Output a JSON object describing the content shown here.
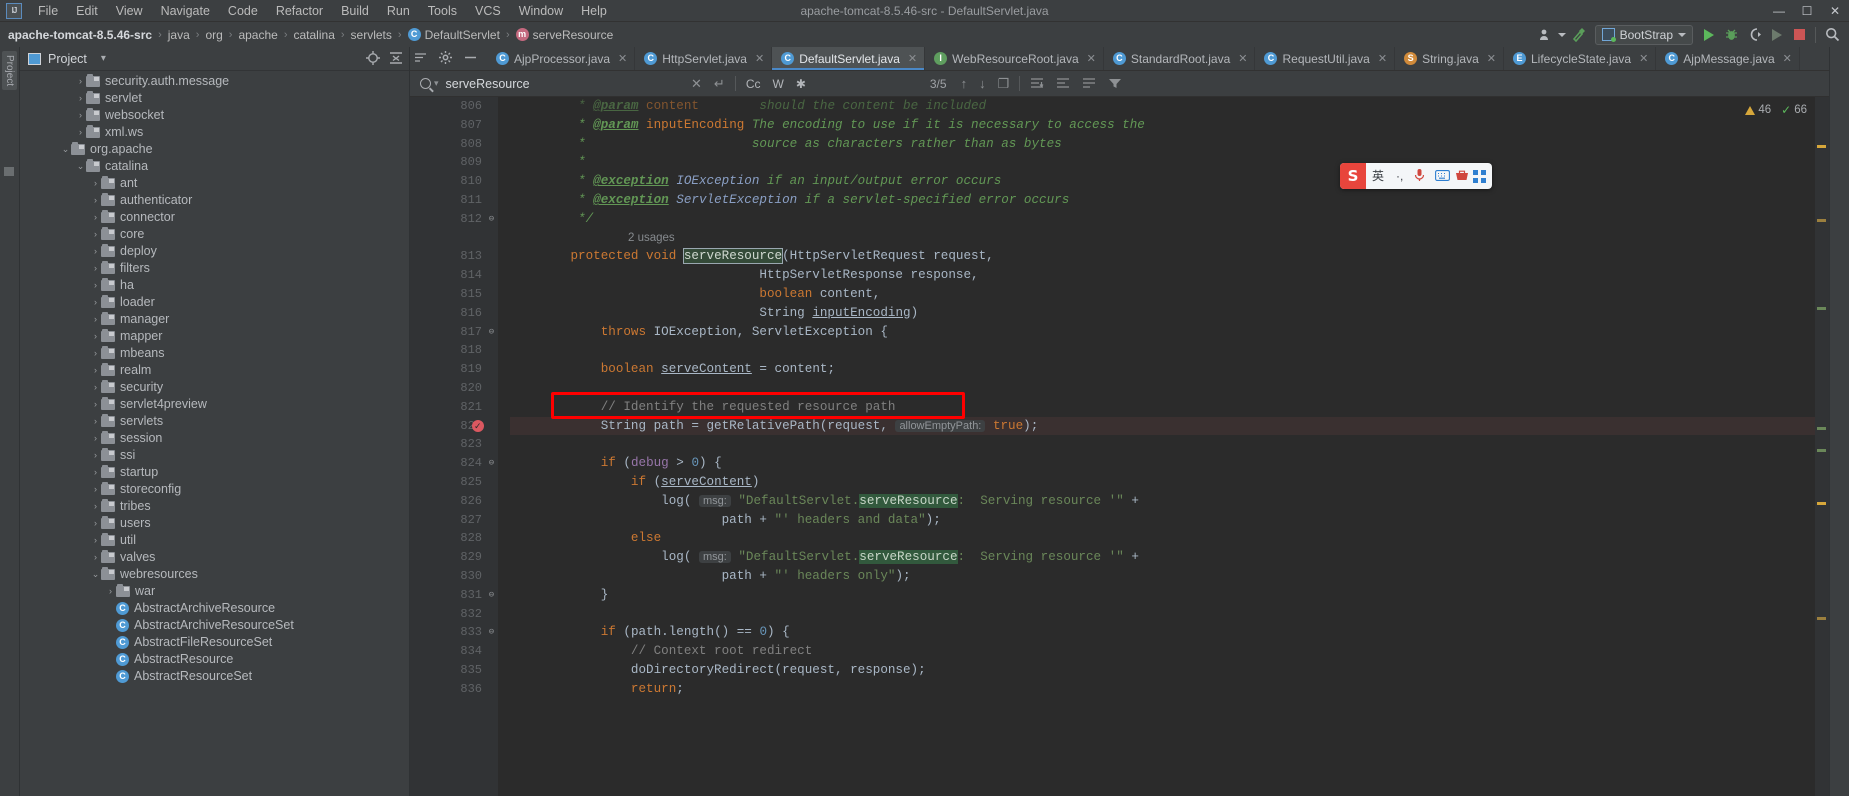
{
  "window": {
    "title": "apache-tomcat-8.5.46-src - DefaultServlet.java",
    "logo": "IJ",
    "minimize": "—",
    "maximize": "☐",
    "close": "✕"
  },
  "menubar": {
    "items": [
      {
        "label": "File"
      },
      {
        "label": "Edit"
      },
      {
        "label": "View"
      },
      {
        "label": "Navigate"
      },
      {
        "label": "Code"
      },
      {
        "label": "Refactor"
      },
      {
        "label": "Build"
      },
      {
        "label": "Run"
      },
      {
        "label": "Tools"
      },
      {
        "label": "VCS"
      },
      {
        "label": "Window"
      },
      {
        "label": "Help"
      }
    ]
  },
  "navbar": {
    "crumbs": [
      {
        "label": "apache-tomcat-8.5.46-src",
        "icon": "none",
        "root": true
      },
      {
        "label": "java",
        "icon": "none"
      },
      {
        "label": "org",
        "icon": "none"
      },
      {
        "label": "apache",
        "icon": "none"
      },
      {
        "label": "catalina",
        "icon": "none"
      },
      {
        "label": "servlets",
        "icon": "none"
      },
      {
        "label": "DefaultServlet",
        "icon": "class-icon",
        "glyph": "C"
      },
      {
        "label": "serveResource",
        "icon": "method-icon",
        "glyph": "m"
      }
    ],
    "separator": "›",
    "run_config": "BootStrap",
    "search_everywhere": "search-icon"
  },
  "project_panel": {
    "title": "Project",
    "dropdown": "▾",
    "tree": [
      {
        "label": "security.auth.message",
        "depth": 3,
        "arrow": "›",
        "type": "folder"
      },
      {
        "label": "servlet",
        "depth": 3,
        "arrow": "›",
        "type": "folder"
      },
      {
        "label": "websocket",
        "depth": 3,
        "arrow": "›",
        "type": "folder"
      },
      {
        "label": "xml.ws",
        "depth": 3,
        "arrow": "›",
        "type": "folder"
      },
      {
        "label": "org.apache",
        "depth": 2,
        "arrow": "⌄",
        "type": "folder"
      },
      {
        "label": "catalina",
        "depth": 3,
        "arrow": "⌄",
        "type": "folder"
      },
      {
        "label": "ant",
        "depth": 4,
        "arrow": "›",
        "type": "folder"
      },
      {
        "label": "authenticator",
        "depth": 4,
        "arrow": "›",
        "type": "folder"
      },
      {
        "label": "connector",
        "depth": 4,
        "arrow": "›",
        "type": "folder"
      },
      {
        "label": "core",
        "depth": 4,
        "arrow": "›",
        "type": "folder"
      },
      {
        "label": "deploy",
        "depth": 4,
        "arrow": "›",
        "type": "folder"
      },
      {
        "label": "filters",
        "depth": 4,
        "arrow": "›",
        "type": "folder"
      },
      {
        "label": "ha",
        "depth": 4,
        "arrow": "›",
        "type": "folder"
      },
      {
        "label": "loader",
        "depth": 4,
        "arrow": "›",
        "type": "folder"
      },
      {
        "label": "manager",
        "depth": 4,
        "arrow": "›",
        "type": "folder"
      },
      {
        "label": "mapper",
        "depth": 4,
        "arrow": "›",
        "type": "folder"
      },
      {
        "label": "mbeans",
        "depth": 4,
        "arrow": "›",
        "type": "folder"
      },
      {
        "label": "realm",
        "depth": 4,
        "arrow": "›",
        "type": "folder"
      },
      {
        "label": "security",
        "depth": 4,
        "arrow": "›",
        "type": "folder"
      },
      {
        "label": "servlet4preview",
        "depth": 4,
        "arrow": "›",
        "type": "folder"
      },
      {
        "label": "servlets",
        "depth": 4,
        "arrow": "›",
        "type": "folder"
      },
      {
        "label": "session",
        "depth": 4,
        "arrow": "›",
        "type": "folder"
      },
      {
        "label": "ssi",
        "depth": 4,
        "arrow": "›",
        "type": "folder"
      },
      {
        "label": "startup",
        "depth": 4,
        "arrow": "›",
        "type": "folder"
      },
      {
        "label": "storeconfig",
        "depth": 4,
        "arrow": "›",
        "type": "folder"
      },
      {
        "label": "tribes",
        "depth": 4,
        "arrow": "›",
        "type": "folder"
      },
      {
        "label": "users",
        "depth": 4,
        "arrow": "›",
        "type": "folder"
      },
      {
        "label": "util",
        "depth": 4,
        "arrow": "›",
        "type": "folder"
      },
      {
        "label": "valves",
        "depth": 4,
        "arrow": "›",
        "type": "folder"
      },
      {
        "label": "webresources",
        "depth": 4,
        "arrow": "⌄",
        "type": "folder"
      },
      {
        "label": "war",
        "depth": 5,
        "arrow": "›",
        "type": "folder"
      },
      {
        "label": "AbstractArchiveResource",
        "depth": 5,
        "arrow": "",
        "type": "class",
        "glyph": "C"
      },
      {
        "label": "AbstractArchiveResourceSet",
        "depth": 5,
        "arrow": "",
        "type": "class",
        "glyph": "C"
      },
      {
        "label": "AbstractFileResourceSet",
        "depth": 5,
        "arrow": "",
        "type": "class",
        "glyph": "C"
      },
      {
        "label": "AbstractResource",
        "depth": 5,
        "arrow": "",
        "type": "class",
        "glyph": "C"
      },
      {
        "label": "AbstractResourceSet",
        "depth": 5,
        "arrow": "",
        "type": "class",
        "glyph": "C"
      }
    ]
  },
  "editor_tabs": {
    "tools": [
      "settings-gear-icon",
      "collapse-icon"
    ],
    "tabs": [
      {
        "label": "AjpProcessor.java",
        "glyph": "C",
        "kind": "class",
        "active": false
      },
      {
        "label": "HttpServlet.java",
        "glyph": "C",
        "kind": "class",
        "active": false
      },
      {
        "label": "DefaultServlet.java",
        "glyph": "C",
        "kind": "class",
        "active": true
      },
      {
        "label": "WebResourceRoot.java",
        "glyph": "I",
        "kind": "interface",
        "active": false
      },
      {
        "label": "StandardRoot.java",
        "glyph": "C",
        "kind": "class",
        "active": false
      },
      {
        "label": "RequestUtil.java",
        "glyph": "C",
        "kind": "class",
        "active": false
      },
      {
        "label": "String.java",
        "glyph": "S",
        "kind": "string",
        "active": false
      },
      {
        "label": "LifecycleState.java",
        "glyph": "E",
        "kind": "enum",
        "active": false
      },
      {
        "label": "AjpMessage.java",
        "glyph": "C",
        "kind": "class",
        "active": false
      }
    ],
    "close_glyph": "✕"
  },
  "findbar": {
    "query": "serveResource",
    "placeholder": "Search",
    "clear": "✕",
    "history": "↵",
    "match_case": "Cc",
    "words": "W",
    "regex": "✱",
    "count": "3/5",
    "prev": "↑",
    "next": "↓",
    "select_all": "❐",
    "filter": "filter-icon"
  },
  "inspection": {
    "warning_count": "46",
    "ok_count": "66"
  },
  "left_strip_label": "Project",
  "ime": {
    "logo": "S",
    "mode": "英",
    "punct": "·,",
    "mic": "mic-icon",
    "keyboard": "keyboard-icon",
    "toolbox": "toolbox-icon",
    "grid": "grid-icon"
  },
  "code": {
    "first_line": 806,
    "lines": [
      {
        "n": 806,
        "partial": true,
        "tokens": [
          {
            "t": "         * ",
            "c": "doc"
          },
          {
            "t": "@param",
            "c": "docTag"
          },
          {
            "t": " content",
            "c": "kw"
          },
          {
            "t": "        should the content be included",
            "c": "doc"
          }
        ]
      },
      {
        "n": 807,
        "tokens": [
          {
            "t": "         * ",
            "c": "doc"
          },
          {
            "t": "@param",
            "c": "docTag"
          },
          {
            "t": " inputEncoding",
            "c": "kw"
          },
          {
            "t": " The encoding to use if it is necessary to access the",
            "c": "doc"
          }
        ]
      },
      {
        "n": 808,
        "tokens": [
          {
            "t": "         *                      source as characters rather than as bytes",
            "c": "doc"
          }
        ]
      },
      {
        "n": 809,
        "tokens": [
          {
            "t": "         *",
            "c": "doc"
          }
        ]
      },
      {
        "n": 810,
        "tokens": [
          {
            "t": "         * ",
            "c": "doc"
          },
          {
            "t": "@exception",
            "c": "docTag"
          },
          {
            "t": " IOException",
            "c": "docType"
          },
          {
            "t": " if an input/output error occurs",
            "c": "doc"
          }
        ]
      },
      {
        "n": 811,
        "tokens": [
          {
            "t": "         * ",
            "c": "doc"
          },
          {
            "t": "@exception",
            "c": "docTag"
          },
          {
            "t": " ServletException",
            "c": "docType"
          },
          {
            "t": " if a servlet-specified error occurs",
            "c": "doc"
          }
        ]
      },
      {
        "n": 812,
        "fold": true,
        "tokens": [
          {
            "t": "         */",
            "c": "doc"
          }
        ]
      },
      {
        "n": null,
        "inlay": "2 usages"
      },
      {
        "n": 813,
        "tokens": [
          {
            "t": "        ",
            "c": "fn"
          },
          {
            "t": "protected void ",
            "c": "kw"
          },
          {
            "t": "serveResource",
            "c": "hitbox"
          },
          {
            "t": "(HttpServletRequest request,",
            "c": "fn"
          }
        ]
      },
      {
        "n": 814,
        "tokens": [
          {
            "t": "                                 HttpServletResponse response,",
            "c": "fn"
          }
        ]
      },
      {
        "n": 815,
        "tokens": [
          {
            "t": "                                 ",
            "c": "fn"
          },
          {
            "t": "boolean ",
            "c": "kw"
          },
          {
            "t": "content,",
            "c": "fn"
          }
        ]
      },
      {
        "n": 816,
        "tokens": [
          {
            "t": "                                 String ",
            "c": "fn"
          },
          {
            "t": "inputEncoding",
            "c": "loc"
          },
          {
            "t": ")",
            "c": "fn"
          }
        ]
      },
      {
        "n": 817,
        "fold": true,
        "tokens": [
          {
            "t": "            ",
            "c": "fn"
          },
          {
            "t": "throws ",
            "c": "kw"
          },
          {
            "t": "IOException, ServletException {",
            "c": "fn"
          }
        ]
      },
      {
        "n": 818,
        "tokens": [
          {
            "t": "",
            "c": "fn"
          }
        ]
      },
      {
        "n": 819,
        "tokens": [
          {
            "t": "            ",
            "c": "fn"
          },
          {
            "t": "boolean ",
            "c": "kw"
          },
          {
            "t": "serveContent",
            "c": "loc"
          },
          {
            "t": " = content;",
            "c": "fn"
          }
        ]
      },
      {
        "n": 820,
        "tokens": [
          {
            "t": "",
            "c": "fn"
          }
        ]
      },
      {
        "n": 821,
        "tokens": [
          {
            "t": "            // Identify the requested resource path",
            "c": "cmt"
          }
        ]
      },
      {
        "n": 822,
        "breakpoint": true,
        "highlight": true,
        "tokens": [
          {
            "t": "            String path = getRelativePath(request, ",
            "c": "fn"
          },
          {
            "t": "allowEmptyPath:",
            "c": "hint"
          },
          {
            "t": " ",
            "c": "fn"
          },
          {
            "t": "true",
            "c": "kw"
          },
          {
            "t": ");",
            "c": "fn"
          }
        ]
      },
      {
        "n": 823,
        "tokens": [
          {
            "t": "",
            "c": "fn"
          }
        ]
      },
      {
        "n": 824,
        "fold": true,
        "tokens": [
          {
            "t": "            ",
            "c": "fn"
          },
          {
            "t": "if ",
            "c": "kw"
          },
          {
            "t": "(",
            "c": "fn"
          },
          {
            "t": "debug",
            "c": "fld"
          },
          {
            "t": " > ",
            "c": "fn"
          },
          {
            "t": "0",
            "c": "num"
          },
          {
            "t": ") {",
            "c": "fn"
          }
        ]
      },
      {
        "n": 825,
        "tokens": [
          {
            "t": "                ",
            "c": "fn"
          },
          {
            "t": "if ",
            "c": "kw"
          },
          {
            "t": "(",
            "c": "fn"
          },
          {
            "t": "serveContent",
            "c": "loc"
          },
          {
            "t": ")",
            "c": "fn"
          }
        ]
      },
      {
        "n": 826,
        "tokens": [
          {
            "t": "                    log( ",
            "c": "fn"
          },
          {
            "t": "msg:",
            "c": "hint"
          },
          {
            "t": " ",
            "c": "fn"
          },
          {
            "t": "\"DefaultServlet.",
            "c": "str"
          },
          {
            "t": "serveResource",
            "c": "hit"
          },
          {
            "t": ":  Serving resource '\"",
            "c": "str"
          },
          {
            "t": " +",
            "c": "fn"
          }
        ]
      },
      {
        "n": 827,
        "tokens": [
          {
            "t": "                            path + ",
            "c": "fn"
          },
          {
            "t": "\"' headers and data\"",
            "c": "str"
          },
          {
            "t": ");",
            "c": "fn"
          }
        ]
      },
      {
        "n": 828,
        "tokens": [
          {
            "t": "                ",
            "c": "fn"
          },
          {
            "t": "else",
            "c": "kw"
          }
        ]
      },
      {
        "n": 829,
        "tokens": [
          {
            "t": "                    log( ",
            "c": "fn"
          },
          {
            "t": "msg:",
            "c": "hint"
          },
          {
            "t": " ",
            "c": "fn"
          },
          {
            "t": "\"DefaultServlet.",
            "c": "str"
          },
          {
            "t": "serveResource",
            "c": "hit"
          },
          {
            "t": ":  Serving resource '\"",
            "c": "str"
          },
          {
            "t": " +",
            "c": "fn"
          }
        ]
      },
      {
        "n": 830,
        "tokens": [
          {
            "t": "                            path + ",
            "c": "fn"
          },
          {
            "t": "\"' headers only\"",
            "c": "str"
          },
          {
            "t": ");",
            "c": "fn"
          }
        ]
      },
      {
        "n": 831,
        "fold": true,
        "tokens": [
          {
            "t": "            }",
            "c": "fn"
          }
        ]
      },
      {
        "n": 832,
        "tokens": [
          {
            "t": "",
            "c": "fn"
          }
        ]
      },
      {
        "n": 833,
        "fold": true,
        "tokens": [
          {
            "t": "            ",
            "c": "fn"
          },
          {
            "t": "if ",
            "c": "kw"
          },
          {
            "t": "(path.length() == ",
            "c": "fn"
          },
          {
            "t": "0",
            "c": "num"
          },
          {
            "t": ") {",
            "c": "fn"
          }
        ]
      },
      {
        "n": 834,
        "tokens": [
          {
            "t": "                // Context root redirect",
            "c": "cmt"
          }
        ]
      },
      {
        "n": 835,
        "tokens": [
          {
            "t": "                doDirectoryRedirect(request, response);",
            "c": "fn"
          }
        ]
      },
      {
        "n": 836,
        "tokens": [
          {
            "t": "                ",
            "c": "fn"
          },
          {
            "t": "return",
            "c": "kw"
          },
          {
            "t": ";",
            "c": "fn"
          }
        ]
      }
    ]
  }
}
